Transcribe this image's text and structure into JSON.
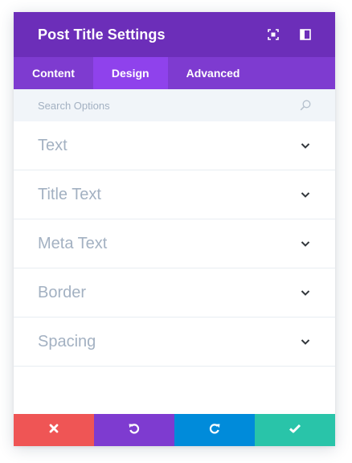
{
  "header": {
    "title": "Post Title Settings",
    "icons": [
      "expand-icon",
      "sidebar-icon"
    ]
  },
  "tabs": [
    {
      "label": "Content",
      "active": false
    },
    {
      "label": "Design",
      "active": true
    },
    {
      "label": "Advanced",
      "active": false
    }
  ],
  "search": {
    "placeholder": "Search Options",
    "icon": "search-icon"
  },
  "toggles": [
    {
      "label": "Text"
    },
    {
      "label": "Title Text"
    },
    {
      "label": "Meta Text"
    },
    {
      "label": "Border"
    },
    {
      "label": "Spacing"
    }
  ],
  "footer": {
    "buttons": [
      {
        "name": "cancel",
        "icon": "close-icon",
        "color": "#ef5555"
      },
      {
        "name": "undo",
        "icon": "undo-icon",
        "color": "#7e3bd0"
      },
      {
        "name": "redo",
        "icon": "redo-icon",
        "color": "#008bda"
      },
      {
        "name": "save",
        "icon": "check-icon",
        "color": "#29c4a9"
      }
    ]
  },
  "colors": {
    "header": "#6c2eb9",
    "tabs": "#7e3bd0",
    "active_tab": "#8f42ec",
    "search_bg": "#f1f5f9",
    "label_text": "#a3b1c2"
  }
}
